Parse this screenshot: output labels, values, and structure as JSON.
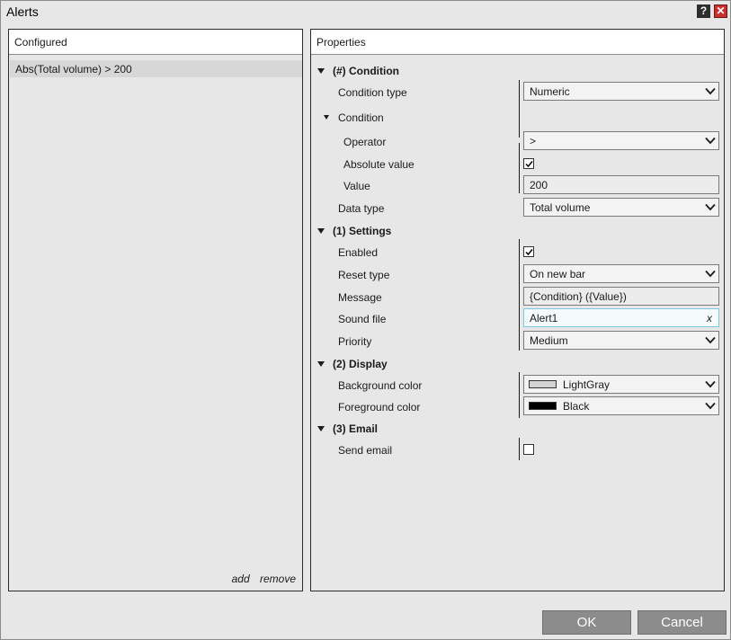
{
  "window": {
    "title": "Alerts",
    "help_glyph": "?",
    "close_glyph": "✕"
  },
  "configured": {
    "header": "Configured",
    "items": [
      "Abs(Total volume) > 200"
    ],
    "add_label": "add",
    "remove_label": "remove"
  },
  "properties": {
    "header": "Properties",
    "condition_group": {
      "title": "(#) Condition",
      "condition_type": {
        "label": "Condition type",
        "value": "Numeric"
      },
      "subgroup_title": "Condition",
      "operator": {
        "label": "Operator",
        "value": ">"
      },
      "absolute_value": {
        "label": "Absolute value",
        "checked": true
      },
      "value": {
        "label": "Value",
        "value": "200"
      },
      "data_type": {
        "label": "Data type",
        "value": "Total volume"
      }
    },
    "settings_group": {
      "title": "(1) Settings",
      "enabled": {
        "label": "Enabled",
        "checked": true
      },
      "reset_type": {
        "label": "Reset type",
        "value": "On new bar"
      },
      "message": {
        "label": "Message",
        "value": "{Condition} ({Value})"
      },
      "sound_file": {
        "label": "Sound file",
        "value": "Alert1",
        "clear_glyph": "x"
      },
      "priority": {
        "label": "Priority",
        "value": "Medium"
      }
    },
    "display_group": {
      "title": "(2) Display",
      "background_color": {
        "label": "Background color",
        "value": "LightGray",
        "swatch": "#d3d3d3"
      },
      "foreground_color": {
        "label": "Foreground color",
        "value": "Black",
        "swatch": "#000000"
      }
    },
    "email_group": {
      "title": "(3) Email",
      "send_email": {
        "label": "Send email",
        "checked": false
      }
    }
  },
  "buttons": {
    "ok": "OK",
    "cancel": "Cancel"
  },
  "colors": {
    "window_bg": "#e7e7e7",
    "button_bg": "#8c8c8c",
    "close_red": "#c9302c",
    "focus_border": "#7ec8e3"
  }
}
